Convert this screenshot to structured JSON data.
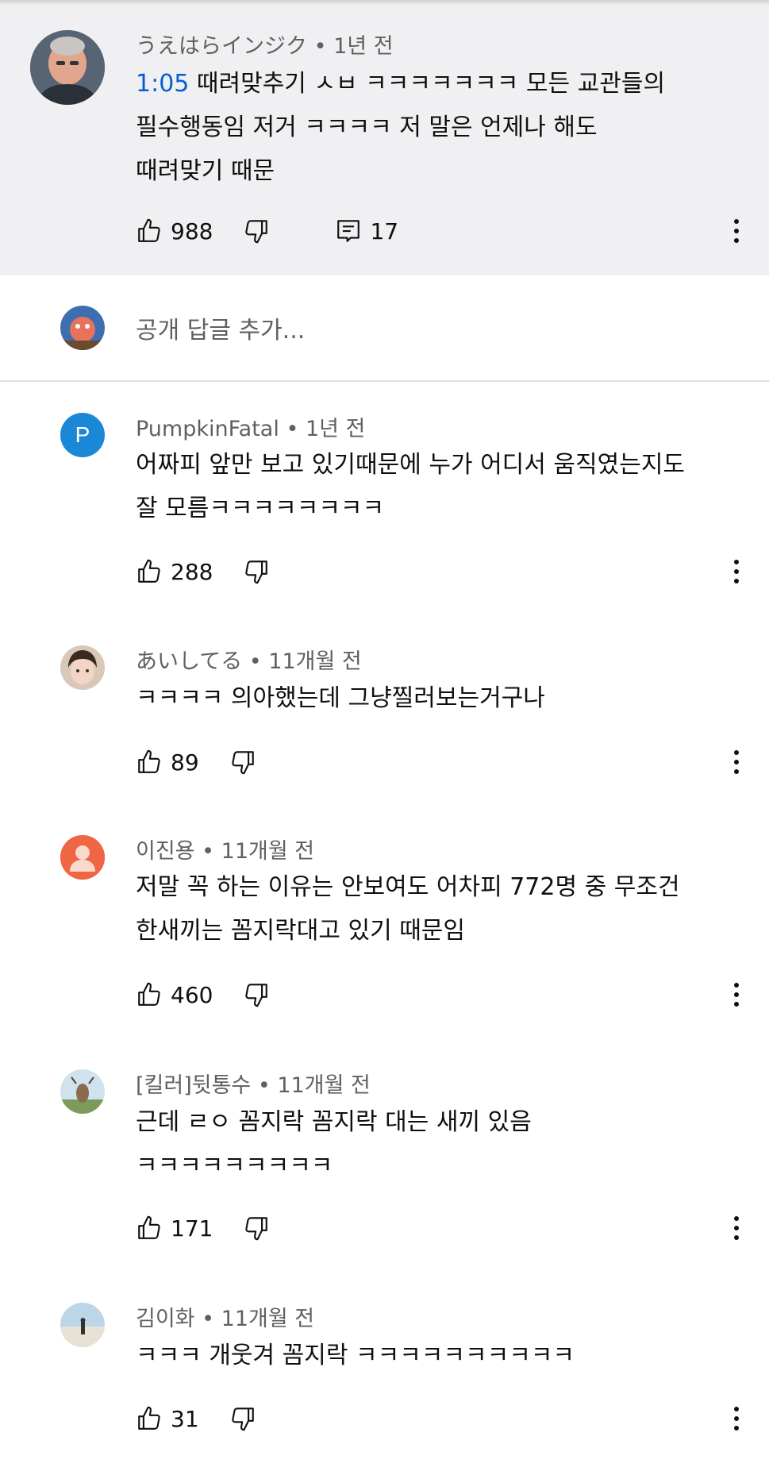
{
  "main_comment": {
    "author": "うえはらインジク",
    "age": "1년 전",
    "timestamp": "1:05",
    "text_line1": " 때려맞추기 ㅅㅂ ㅋㅋㅋㅋㅋㅋㅋ 모든 교관들의",
    "text_line2": "필수행동임 저거 ㅋㅋㅋㅋ 저 말은 언제나 해도",
    "text_line3": "때려맞기 때문",
    "likes": "988",
    "replies": "17"
  },
  "reply_input": {
    "placeholder": "공개 답글 추가..."
  },
  "replies": [
    {
      "author": "PumpkinFatal",
      "age": "1년 전",
      "avatar_letter": "P",
      "line1": "어짜피 앞만 보고 있기때문에 누가 어디서 움직였는지도",
      "line2": "잘 모름ㅋㅋㅋㅋㅋㅋㅋㅋ",
      "likes": "288"
    },
    {
      "author": "あいしてる",
      "age": "11개월 전",
      "line1": "ㅋㅋㅋㅋ 의아했는데 그냥찔러보는거구나",
      "likes": "89"
    },
    {
      "author": "이진용",
      "age": "11개월 전",
      "line1": "저말 꼭 하는 이유는 안보여도 어차피 772명 중 무조건",
      "line2": "한새끼는 꼼지락대고 있기 때문임",
      "likes": "460"
    },
    {
      "author": "[킬러]뒷통수",
      "age": "11개월 전",
      "line1": "근데 ㄹㅇ 꼼지락 꼼지락 대는 새끼 있음",
      "line2": "ㅋㅋㅋㅋㅋㅋㅋㅋㅋ",
      "likes": "171"
    },
    {
      "author": "김이화",
      "age": "11개월 전",
      "line1": "ㅋㅋㅋ 개웃겨 꼼지락 ㅋㅋㅋㅋㅋㅋㅋㅋㅋㅋ",
      "likes": "31"
    }
  ],
  "icons": {
    "like": "thumbs-up-icon",
    "dislike": "thumbs-down-icon",
    "reply": "reply-icon",
    "more": "more-vert-icon"
  },
  "colors": {
    "highlight_bg": "#f0eff2",
    "link_blue": "#065fd4",
    "meta_gray": "#606060"
  }
}
